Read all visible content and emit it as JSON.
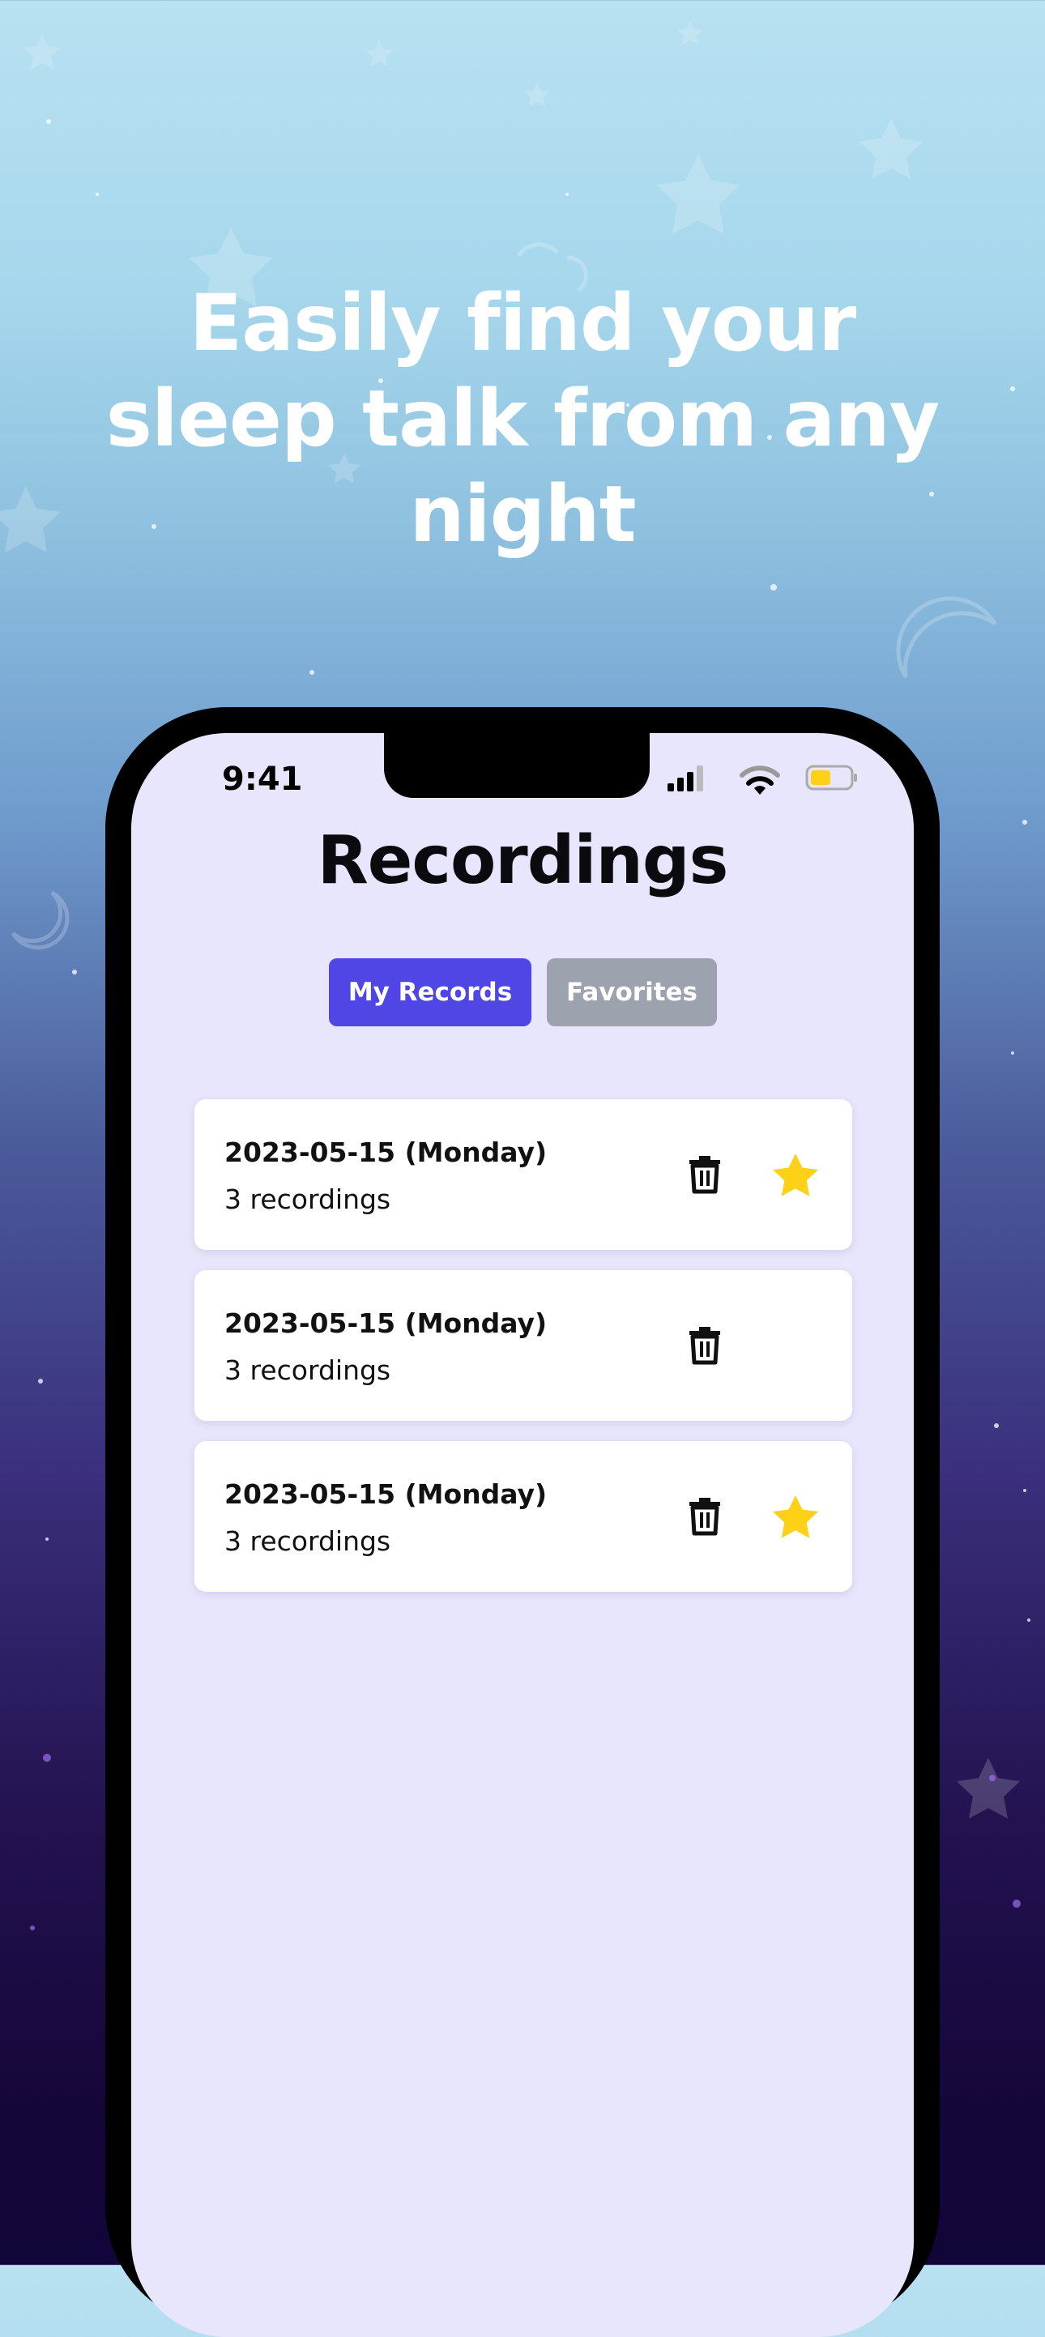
{
  "headline": {
    "line1": "Easily find your",
    "line2": "sleep talk from any night"
  },
  "status_bar": {
    "time": "9:41",
    "icons": [
      "cellular-signal-icon",
      "wifi-icon",
      "battery-icon"
    ]
  },
  "screen": {
    "title": "Recordings",
    "tabs": [
      {
        "label": "My Records",
        "active": true
      },
      {
        "label": "Favorites",
        "active": false
      }
    ],
    "records": [
      {
        "date": "2023-05-15 (Monday)",
        "count": "3 recordings",
        "favorite": true
      },
      {
        "date": "2023-05-15 (Monday)",
        "count": "3 recordings",
        "favorite": false
      },
      {
        "date": "2023-05-15 (Monday)",
        "count": "3 recordings",
        "favorite": true
      }
    ]
  },
  "colors": {
    "accent": "#4f46e5",
    "tab_inactive": "#9ca3af",
    "screen_bg": "#e8e6fc",
    "star": "#fcd116"
  }
}
